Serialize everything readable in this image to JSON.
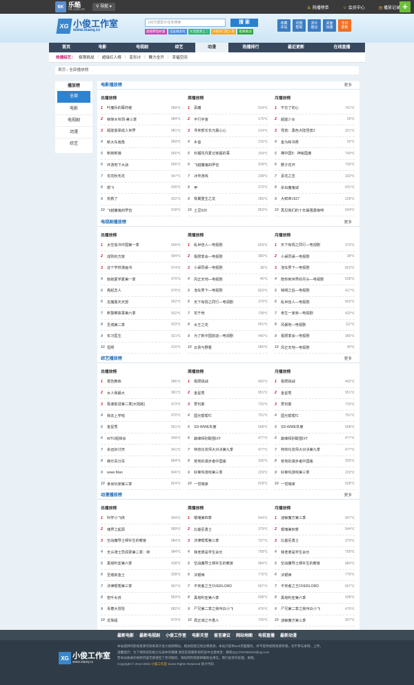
{
  "topbar": {
    "logo_mark": "6K",
    "logo_name": "乐酷",
    "logo_sub": "6K.com.cn",
    "nav_label": "导航",
    "links": [
      "热播榜单",
      "会员中心",
      "播放记录"
    ],
    "plus": "+"
  },
  "header": {
    "logo_mark": "XG",
    "logo_title": "小俊工作室",
    "logo_url": "www.xiaoq.cc",
    "search_placeholder": "100万部影片任你搜索",
    "search_button": "搜 索",
    "quick_tags": [
      {
        "label": "超级/野蛮娇妻",
        "color": "#c844b6"
      },
      {
        "label": "这届城会玩",
        "color": "#3f8de0"
      },
      {
        "label": "大话西游之二",
        "color": "#2bb673"
      },
      {
        "label": "冷热笑门吃八卦",
        "color": "#f5a623"
      },
      {
        "label": "极限挑战",
        "color": "#2aa836"
      }
    ],
    "icons": [
      {
        "line1": "收藏",
        "line2": "本站"
      },
      {
        "line1": "问题",
        "line2": "帮助"
      },
      {
        "line1": "求片",
        "line2": "建议"
      },
      {
        "line1": "桌面",
        "line2": "快捷"
      },
      {
        "line1": "今日",
        "line2": "更新"
      }
    ]
  },
  "nav": {
    "items": [
      "首页",
      "电影",
      "电视剧",
      "综艺",
      "动漫",
      "热播排行",
      "最近更新",
      "在线直播"
    ],
    "active_index": 4
  },
  "subnav": {
    "label": "热播综艺：",
    "items": [
      "极限挑战",
      "超级红人榜",
      "变形计",
      "舞力全开",
      "幸福空间"
    ]
  },
  "breadcrumb": [
    "首页",
    "全部播放榜"
  ],
  "sidebar": {
    "title": "播放榜",
    "items": [
      "全部",
      "电影",
      "电视剧",
      "动漫",
      "综艺"
    ],
    "active_index": 0
  },
  "more_label": "更多",
  "col_headers": [
    "总播放榜",
    "周播放榜",
    "月播放榜"
  ],
  "sections": [
    {
      "title": "电影播放榜",
      "columns": [
        [
          [
            "叶/魔兵的幕府者",
            "989℃"
          ],
          [
            "绑架/水帘洞-第三季",
            "984℃"
          ],
          [
            "超能/富豪/成人世界",
            "981℃"
          ],
          [
            "新大/东南角",
            "969℃"
          ],
          [
            "新郎新娘",
            "966℃"
          ],
          [
            "环游/地下大战",
            "956℃"
          ],
          [
            "花花/秋毛花",
            "947℃"
          ],
          [
            "想飞",
            "930℃"
          ],
          [
            "抢救/了",
            "922℃"
          ],
          [
            "飞越/魔鬼/四/罗伍",
            "918℃"
          ]
        ],
        [
          [
            "恶魔",
            "914℃"
          ],
          [
            "平行宇宙",
            "170℃"
          ],
          [
            "寻亲/部长/长/元/最/心/心",
            "214℃"
          ],
          [
            "乡音",
            "216℃"
          ],
          [
            "石榴/花月/夏记/家/庭的/事",
            "154℃"
          ],
          [
            "飞越/魔鬼/四/罗伍",
            "918℃"
          ],
          [
            "冰/传/游戏",
            "238℃"
          ],
          [
            "甲",
            "373℃"
          ],
          [
            "铁/翼重生/之/龙",
            "285℃"
          ],
          [
            "土/豆520",
            "853℃"
          ]
        ],
        [
          [
            "不忘了初心",
            "741℃"
          ],
          [
            "超能/少女",
            "26℃"
          ],
          [
            "怪/兽/：黑/色/大/陆/怪兽2",
            "321℃"
          ],
          [
            "金/为/和/书/男",
            "92℃"
          ],
          [
            "擦/中/国5：/神/秘/国/度",
            "749℃"
          ],
          [
            "野/子/花开",
            "736℃"
          ],
          [
            "喜/花/之/恋",
            "320℃"
          ],
          [
            "杀/出/魔/鬼城",
            "631℃"
          ],
          [
            "大/鲜/命1927",
            "228℃"
          ],
          [
            "再见/我们的十年/最/强/黑/咖/啡",
            "634℃"
          ]
        ]
      ]
    },
    {
      "title": "电视剧播放榜",
      "columns": [
        [
          [
            "太空/追/书/中/国/第/一/季",
            "999℃"
          ],
          [
            "成/则/的/方/旅",
            "994℃"
          ],
          [
            "这个/学/校/漫/画/书",
            "974℃"
          ],
          [
            "她/她/夏/学/夏/第/一/季",
            "970℃"
          ],
          [
            "亮/起/恋/人",
            "970℃"
          ],
          [
            "龙/魔/黑/天/天/部",
            "952℃"
          ],
          [
            "新/警/察/故/事/第/六/季",
            "932℃"
          ],
          [
            "圣/城/第/二/季",
            "923℃"
          ],
          [
            "实/习/医/生",
            "921℃"
          ],
          [
            "恒/照",
            "910℃"
          ]
        ],
        [
          [
            "乱/世/佳/人—电视剧",
            "603℃"
          ],
          [
            "极/限/季/会—电视剧",
            "385℃"
          ],
          [
            "小/桌/同/桌—电视剧",
            "38℃"
          ],
          [
            "风/正/天/地—电视剧",
            "40℃"
          ],
          [
            "泡/车/男/下—电视剧",
            "823℃"
          ],
          [
            "天/下/有/情/之/同/行—电视剧",
            "379℃"
          ],
          [
            "花/千/骨",
            "708℃"
          ],
          [
            "女/王/之/花",
            "901℃"
          ],
          [
            "为/了/新/中/国/前/进—电视剧",
            "440℃"
          ],
          [
            "云/贵/与/野/香",
            "580℃"
          ]
        ],
        [
          [
            "天/下/有/情/之/同/行—电视剧",
            "379℃"
          ],
          [
            "小/桌/同/桌—电视剧",
            "38℃"
          ],
          [
            "泡/车/男/下—电视剧",
            "823℃"
          ],
          [
            "陪/你/到/世/界/的/尽/头—电视剧",
            "638℃"
          ],
          [
            "锦/绣/之/后—电视剧",
            "417℃"
          ],
          [
            "乱/世/佳/人—电视剧",
            "603℃"
          ],
          [
            "考/生/一/家/亲—电视剧",
            "420℃"
          ],
          [
            "风/暴/地—电视剧",
            "111℃"
          ],
          [
            "极/限/季/会—电视剧",
            "385℃"
          ],
          [
            "风/正/天/地—电视剧",
            "40℃"
          ]
        ]
      ]
    },
    {
      "title": "综艺播放榜",
      "columns": [
        [
          [
            "报/告/教/练",
            "986℃"
          ],
          [
            "女/人/我/最/大",
            "981℃"
          ],
          [
            "极/速/前/进/第/二/季[大陆版]",
            "973℃"
          ],
          [
            "我/去/上/学/啦",
            "970℃"
          ],
          [
            "金/星/秀",
            "951℃"
          ],
          [
            "WTO/姐/妹/会",
            "949℃"
          ],
          [
            "余/远/好/讨/厌",
            "941℃"
          ],
          [
            "娱/乐/百/分/百",
            "884℃"
          ],
          [
            "www Man",
            "846℃"
          ],
          [
            "食/尚/玩/家/第/三/季",
            "824℃"
          ]
        ],
        [
          [
            "极/限/挑/战",
            "492℃"
          ],
          [
            "金/星/秀",
            "951℃"
          ],
          [
            "爱/玩/客",
            "733℃"
          ],
          [
            "国/光/帮/帮/忙",
            "791℃"
          ],
          [
            "SD-WWE/年/度",
            "598℃"
          ],
          [
            "巅/峰/拜/别/联/盟IXT",
            "477℃"
          ],
          [
            "特/效/化/妆/师/大/对/决/第/九/季",
            "477℃"
          ],
          [
            "荒/地/的/漫/步/者/中/国/版",
            "335℃"
          ],
          [
            "好/莱/坞/游/戏/第/三/季",
            "229℃"
          ],
          [
            "一/觉/瑞/家",
            "528℃"
          ]
        ],
        [
          [
            "极/限/挑/战",
            "492℃"
          ],
          [
            "金/星/秀",
            "951℃"
          ],
          [
            "爱/玩/客",
            "733℃"
          ],
          [
            "国/光/帮/帮/忙",
            "791℃"
          ],
          [
            "SD-WWE/年/度",
            "598℃"
          ],
          [
            "巅/峰/拜/别/联/盟IXT",
            "477℃"
          ],
          [
            "特/效/化/妆/师/大/对/决/第/九/季",
            "477℃"
          ],
          [
            "荒/地/的/漫/步/者/中/国/版",
            "335℃"
          ],
          [
            "好/莱/坞/游/戏/第/三/季",
            "229℃"
          ],
          [
            "一/觉/瑞/家",
            "528℃"
          ]
        ]
      ]
    },
    {
      "title": "动漫播放榜",
      "columns": [
        [
          [
            "科/学/小/飞/侠",
            "994℃"
          ],
          [
            "魂/界/之/起/源",
            "989℃"
          ],
          [
            "空/战/魔/导/士/候/补/生/的/教/官",
            "984℃"
          ],
          [
            "无/头/骑/士/异/闻/录/第/二/季：转",
            "984℃"
          ],
          [
            "黑/塔/利/亚/第/六/季",
            "938℃"
          ],
          [
            "圣/痕/炼/金/士",
            "928℃"
          ],
          [
            "法/律/帮/帮/第/三/季",
            "907℃"
          ],
          [
            "密/叶/女/孩",
            "893℃"
          ],
          [
            "青/春/大/冒/险",
            "882℃"
          ],
          [
            "龙/珠/超",
            "879℃"
          ]
        ],
        [
          [
            "银/魂/第/四/季",
            "544℃"
          ],
          [
            "比/基/尼/勇/士",
            "379℃"
          ],
          [
            "法/律/帮/帮/第/三/季",
            "707℃"
          ],
          [
            "我/老/婆/是/学/生/会/长",
            "758℃"
          ],
          [
            "空/战/魔/导/士/候/补/生/的/教/官",
            "984℃"
          ],
          [
            "浒/银/西",
            "776℃"
          ],
          [
            "不/死/者/之/王/OVERLORD",
            "607℃"
          ],
          [
            "黑/塔/利/亚/第/六/季",
            "938℃"
          ],
          [
            "尸/兄/第/二/季/之/我/叫/白/小/飞",
            "476℃"
          ],
          [
            "周/正/城/之/不/愚/人",
            "705℃"
          ]
        ],
        [
          [
            "迷/鲸/魔/方/第/三/季",
            "907℃"
          ],
          [
            "银/魂/第/四/季",
            "544℃"
          ],
          [
            "比/基/尼/勇/士",
            "379℃"
          ],
          [
            "我/老/婆/是/学/生/会/长",
            "758℃"
          ],
          [
            "空/战/魔/导/士/候/补/生/的/教/官",
            "984℃"
          ],
          [
            "浒/银/西",
            "776℃"
          ],
          [
            "不/死/者/之/王/OVERLORD",
            "607℃"
          ],
          [
            "黑/塔/利/亚/第/六/季",
            "938℃"
          ],
          [
            "尸/兄/第/二/季/之/我/叫/白/小/飞",
            "476℃"
          ],
          [
            "迷/鲸/魔/方/第/三/季",
            "907℃"
          ]
        ]
      ]
    }
  ],
  "footer": {
    "links": [
      "最新电影",
      "最新电视剧",
      "小俊工作室",
      "电影天堂",
      "留言建议",
      "网站地图",
      "电视直播",
      "最新动漫"
    ],
    "logo_mark": "XG",
    "logo_title": "小俊工作室",
    "logo_url": "www.xiaoq.cc",
    "lines": [
      "本站提供的影视资源均系来源于各大视频网站，相关链接已经注明来源，本站只提供web页面服务，并不提供视频资源存储，也不参与录制、上传。",
      "温馨提示：为了保持您的视力与身体的健康 请您在观看影视的途中注意休息：联系QQ:2787850323@qq.com",
      "若本站收录的视频内容无意侵犯了贵司版权，请给网页底部邮箱地址来信，我们会及时处理，谢谢。"
    ],
    "copyright_prefix": "Copyright © 2014-2015",
    "copyright_brand": "小俊工作室",
    "copyright_suffix": "Some Rights Reserved 统计代码"
  }
}
